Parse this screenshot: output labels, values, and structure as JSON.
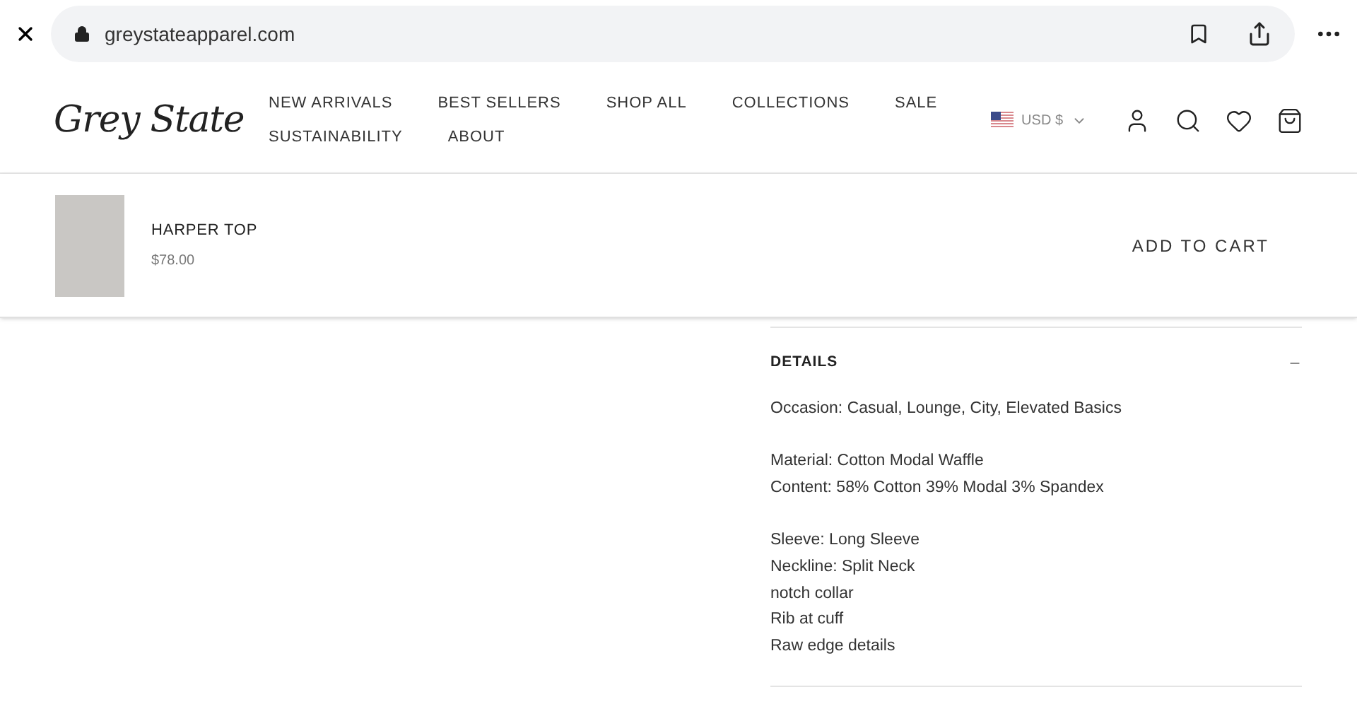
{
  "browser": {
    "url": "greystateapparel.com"
  },
  "header": {
    "logo": "Grey State",
    "nav": [
      [
        "NEW ARRIVALS",
        "BEST SELLERS",
        "SHOP ALL",
        "COLLECTIONS",
        "SALE"
      ],
      [
        "SUSTAINABILITY",
        "ABOUT"
      ]
    ],
    "currency": "USD $"
  },
  "sticky_bar": {
    "product": "HARPER TOP",
    "price": "$78.00",
    "button": "ADD TO CART"
  },
  "details": {
    "title": "DETAILS",
    "expanded": true,
    "groups": [
      [
        "Occasion: Casual, Lounge, City, Elevated Basics"
      ],
      [
        "Material: Cotton Modal Waffle",
        "Content: 58% Cotton 39% Modal 3% Spandex"
      ],
      [
        "Sleeve: Long Sleeve",
        "Neckline: Split Neck",
        "notch collar",
        "Rib at cuff",
        "Raw edge details"
      ]
    ]
  }
}
